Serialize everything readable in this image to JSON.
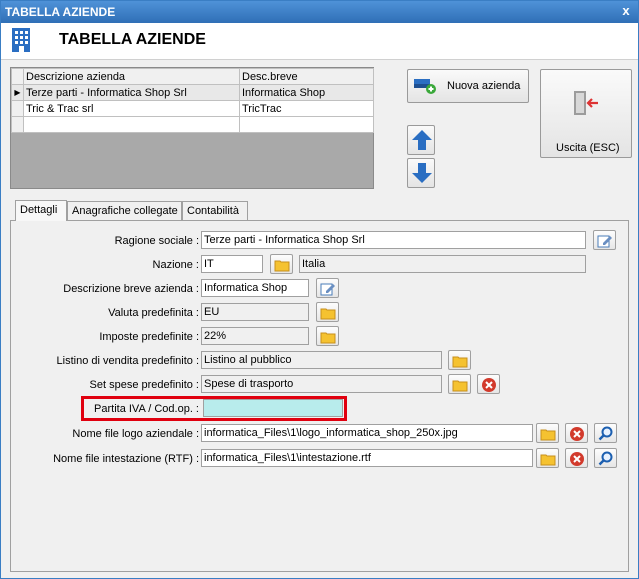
{
  "window": {
    "title": "TABELLA AZIENDE",
    "close": "x"
  },
  "header": {
    "title": "TABELLA AZIENDE",
    "icon": "building-icon"
  },
  "grid": {
    "columns": [
      "Descrizione azienda",
      "Desc.breve"
    ],
    "rows": [
      {
        "desc": "Terze parti - Informatica Shop Srl",
        "breve": "Informatica Shop",
        "indicator": "▶"
      },
      {
        "desc": "Tric & Trac srl",
        "breve": "TricTrac",
        "indicator": ""
      }
    ]
  },
  "buttons": {
    "nuova": "Nuova azienda",
    "uscita": "Uscita (ESC)"
  },
  "tabs": [
    "Dettagli",
    "Anagrafiche collegate",
    "Contabilità"
  ],
  "form": {
    "ragione_label": "Ragione sociale :",
    "ragione_value": "Terze parti - Informatica Shop Srl",
    "nazione_label": "Nazione :",
    "nazione_code": "IT",
    "nazione_name": "Italia",
    "desc_breve_label": "Descrizione breve azienda :",
    "desc_breve_value": "Informatica Shop",
    "valuta_label": "Valuta predefinita :",
    "valuta_value": "EU",
    "imposte_label": "Imposte predefinite :",
    "imposte_value": "22%",
    "listino_label": "Listino di vendita predefinito :",
    "listino_value": "Listino al pubblico",
    "spese_label": "Set spese predefinito :",
    "spese_value": "Spese di trasporto",
    "piva_label": "Partita IVA / Cod.op. :",
    "piva_value": "",
    "logo_label": "Nome file logo aziendale :",
    "logo_value": "informatica_Files\\1\\logo_informatica_shop_250x.jpg",
    "rtf_label": "Nome file intestazione (RTF) :",
    "rtf_value": "informatica_Files\\1\\intestazione.rtf"
  },
  "colors": {
    "title_bar": "#2f6fb6",
    "highlight_box": "#e0000f",
    "piva_field": "#b8ecec"
  }
}
